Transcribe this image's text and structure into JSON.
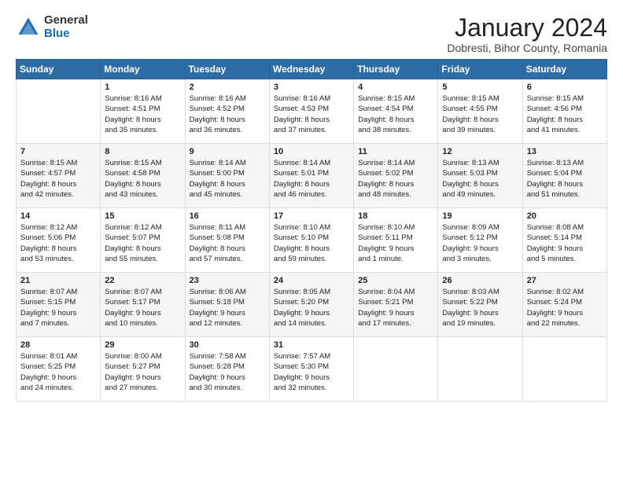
{
  "logo": {
    "general": "General",
    "blue": "Blue"
  },
  "title": "January 2024",
  "subtitle": "Dobresti, Bihor County, Romania",
  "days_header": [
    "Sunday",
    "Monday",
    "Tuesday",
    "Wednesday",
    "Thursday",
    "Friday",
    "Saturday"
  ],
  "weeks": [
    [
      {
        "day": "",
        "info": ""
      },
      {
        "day": "1",
        "info": "Sunrise: 8:16 AM\nSunset: 4:51 PM\nDaylight: 8 hours\nand 35 minutes."
      },
      {
        "day": "2",
        "info": "Sunrise: 8:16 AM\nSunset: 4:52 PM\nDaylight: 8 hours\nand 36 minutes."
      },
      {
        "day": "3",
        "info": "Sunrise: 8:16 AM\nSunset: 4:53 PM\nDaylight: 8 hours\nand 37 minutes."
      },
      {
        "day": "4",
        "info": "Sunrise: 8:15 AM\nSunset: 4:54 PM\nDaylight: 8 hours\nand 38 minutes."
      },
      {
        "day": "5",
        "info": "Sunrise: 8:15 AM\nSunset: 4:55 PM\nDaylight: 8 hours\nand 39 minutes."
      },
      {
        "day": "6",
        "info": "Sunrise: 8:15 AM\nSunset: 4:56 PM\nDaylight: 8 hours\nand 41 minutes."
      }
    ],
    [
      {
        "day": "7",
        "info": "Sunrise: 8:15 AM\nSunset: 4:57 PM\nDaylight: 8 hours\nand 42 minutes."
      },
      {
        "day": "8",
        "info": "Sunrise: 8:15 AM\nSunset: 4:58 PM\nDaylight: 8 hours\nand 43 minutes."
      },
      {
        "day": "9",
        "info": "Sunrise: 8:14 AM\nSunset: 5:00 PM\nDaylight: 8 hours\nand 45 minutes."
      },
      {
        "day": "10",
        "info": "Sunrise: 8:14 AM\nSunset: 5:01 PM\nDaylight: 8 hours\nand 46 minutes."
      },
      {
        "day": "11",
        "info": "Sunrise: 8:14 AM\nSunset: 5:02 PM\nDaylight: 8 hours\nand 48 minutes."
      },
      {
        "day": "12",
        "info": "Sunrise: 8:13 AM\nSunset: 5:03 PM\nDaylight: 8 hours\nand 49 minutes."
      },
      {
        "day": "13",
        "info": "Sunrise: 8:13 AM\nSunset: 5:04 PM\nDaylight: 8 hours\nand 51 minutes."
      }
    ],
    [
      {
        "day": "14",
        "info": "Sunrise: 8:12 AM\nSunset: 5:06 PM\nDaylight: 8 hours\nand 53 minutes."
      },
      {
        "day": "15",
        "info": "Sunrise: 8:12 AM\nSunset: 5:07 PM\nDaylight: 8 hours\nand 55 minutes."
      },
      {
        "day": "16",
        "info": "Sunrise: 8:11 AM\nSunset: 5:08 PM\nDaylight: 8 hours\nand 57 minutes."
      },
      {
        "day": "17",
        "info": "Sunrise: 8:10 AM\nSunset: 5:10 PM\nDaylight: 8 hours\nand 59 minutes."
      },
      {
        "day": "18",
        "info": "Sunrise: 8:10 AM\nSunset: 5:11 PM\nDaylight: 9 hours\nand 1 minute."
      },
      {
        "day": "19",
        "info": "Sunrise: 8:09 AM\nSunset: 5:12 PM\nDaylight: 9 hours\nand 3 minutes."
      },
      {
        "day": "20",
        "info": "Sunrise: 8:08 AM\nSunset: 5:14 PM\nDaylight: 9 hours\nand 5 minutes."
      }
    ],
    [
      {
        "day": "21",
        "info": "Sunrise: 8:07 AM\nSunset: 5:15 PM\nDaylight: 9 hours\nand 7 minutes."
      },
      {
        "day": "22",
        "info": "Sunrise: 8:07 AM\nSunset: 5:17 PM\nDaylight: 9 hours\nand 10 minutes."
      },
      {
        "day": "23",
        "info": "Sunrise: 8:06 AM\nSunset: 5:18 PM\nDaylight: 9 hours\nand 12 minutes."
      },
      {
        "day": "24",
        "info": "Sunrise: 8:05 AM\nSunset: 5:20 PM\nDaylight: 9 hours\nand 14 minutes."
      },
      {
        "day": "25",
        "info": "Sunrise: 8:04 AM\nSunset: 5:21 PM\nDaylight: 9 hours\nand 17 minutes."
      },
      {
        "day": "26",
        "info": "Sunrise: 8:03 AM\nSunset: 5:22 PM\nDaylight: 9 hours\nand 19 minutes."
      },
      {
        "day": "27",
        "info": "Sunrise: 8:02 AM\nSunset: 5:24 PM\nDaylight: 9 hours\nand 22 minutes."
      }
    ],
    [
      {
        "day": "28",
        "info": "Sunrise: 8:01 AM\nSunset: 5:25 PM\nDaylight: 9 hours\nand 24 minutes."
      },
      {
        "day": "29",
        "info": "Sunrise: 8:00 AM\nSunset: 5:27 PM\nDaylight: 9 hours\nand 27 minutes."
      },
      {
        "day": "30",
        "info": "Sunrise: 7:58 AM\nSunset: 5:28 PM\nDaylight: 9 hours\nand 30 minutes."
      },
      {
        "day": "31",
        "info": "Sunrise: 7:57 AM\nSunset: 5:30 PM\nDaylight: 9 hours\nand 32 minutes."
      },
      {
        "day": "",
        "info": ""
      },
      {
        "day": "",
        "info": ""
      },
      {
        "day": "",
        "info": ""
      }
    ]
  ]
}
